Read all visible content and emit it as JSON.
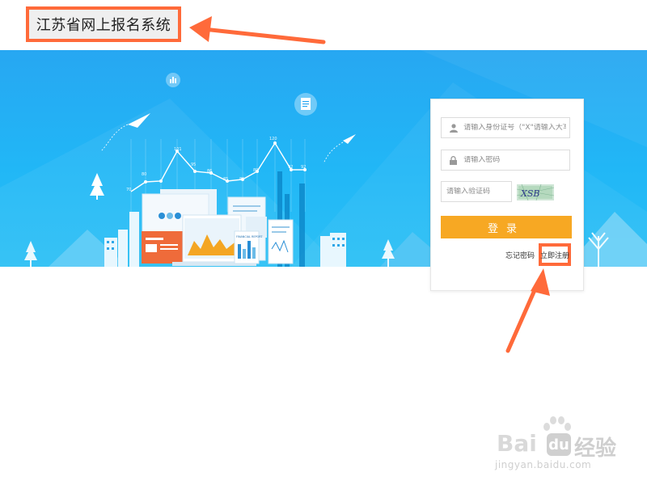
{
  "header": {
    "site_title": "江苏省网上报名系统"
  },
  "hero": {
    "chart_point_labels": [
      "70",
      "80",
      "101",
      "95",
      "86",
      "85",
      "85",
      "89",
      "120",
      "92",
      "92"
    ],
    "report_title": "FINANCIAL REPORT"
  },
  "login": {
    "id_placeholder": "请输入身份证号（\"X\"请输入大写）",
    "password_placeholder": "请输入密码",
    "captcha_placeholder": "请输入验证码",
    "captcha_text": "XSB",
    "login_button": "登录",
    "forgot_link": "忘记密码",
    "register_link": "立即注册"
  },
  "watermark": {
    "brand": "Bai",
    "brand_du": "du",
    "jingyan": "经验",
    "url": "jingyan.baidu.com"
  },
  "colors": {
    "accent_orange": "#ff6a3a",
    "login_button": "#f7a823",
    "hero_blue": "#27a7f2"
  }
}
